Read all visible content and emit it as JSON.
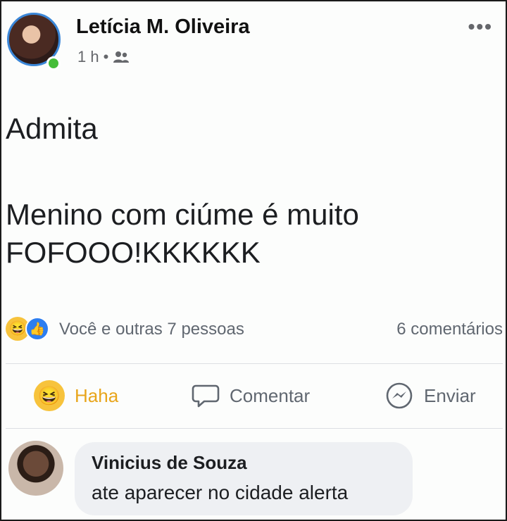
{
  "post": {
    "author": "Letícia M. Oliveira",
    "time": "1 h",
    "separator": "•",
    "audience_icon": "friends-icon",
    "more_icon": "•••",
    "text_line1": "Admita",
    "text_line2": "Menino com ciúme é muito FOFOOO!KKKKKK"
  },
  "reactions": {
    "icons": [
      "haha-icon",
      "like-icon"
    ],
    "summary": "Você e outras 7 pessoas",
    "comments": "6 comentários"
  },
  "actions": {
    "haha_label": "Haha",
    "comment_label": "Comentar",
    "send_label": "Enviar"
  },
  "comment": {
    "author": "Vinicius de Souza",
    "text": "ate aparecer no cidade alerta"
  },
  "colors": {
    "haha_active": "#e8a51b",
    "online": "#45bd38",
    "like_blue": "#2d7ef0"
  }
}
